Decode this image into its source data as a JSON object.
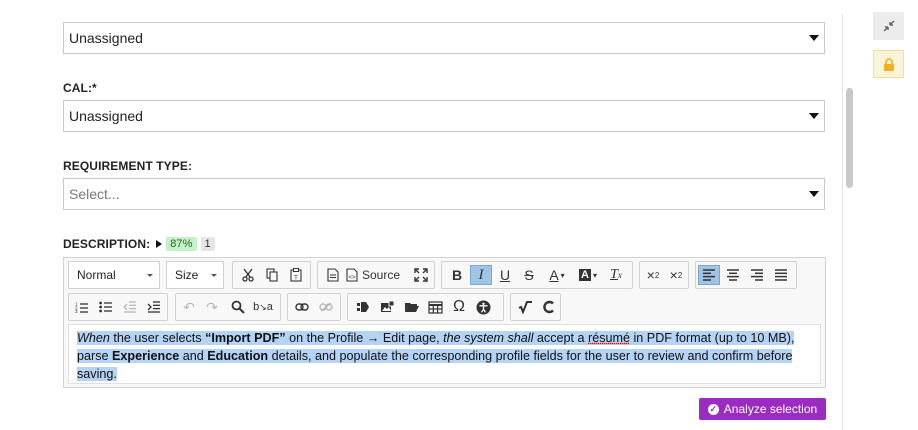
{
  "fields": {
    "first_select": {
      "value": "Unassigned"
    },
    "cal": {
      "label": "CAL:*",
      "value": "Unassigned"
    },
    "requirement_type": {
      "label": "REQUIREMENT TYPE:",
      "placeholder": "Select..."
    },
    "description": {
      "label": "DESCRIPTION:",
      "score": "87%",
      "count": "1"
    }
  },
  "toolbar": {
    "format": "Normal",
    "size": "Size",
    "source": "Source"
  },
  "editor_content": {
    "w1": "When",
    "t1": " the user selects ",
    "w2": "“Import PDF”",
    "t2": " on the Profile → Edit page, ",
    "w3": "the system shall",
    "t3": " accept a ",
    "w4": "résumé",
    "t4": " in PDF format (up to 10 MB), parse ",
    "w5": "Experience",
    "t5": " and ",
    "w6": "Education",
    "t6": " details, and populate the corresponding profile fields for the user to review and confirm before saving."
  },
  "actions": {
    "analyze": "Analyze selection"
  },
  "colors": {
    "accent": "#9b2cc2",
    "highlight": "#b4d3f5",
    "badge_green": "#c8f0c8",
    "lock": "#f2b01e"
  }
}
